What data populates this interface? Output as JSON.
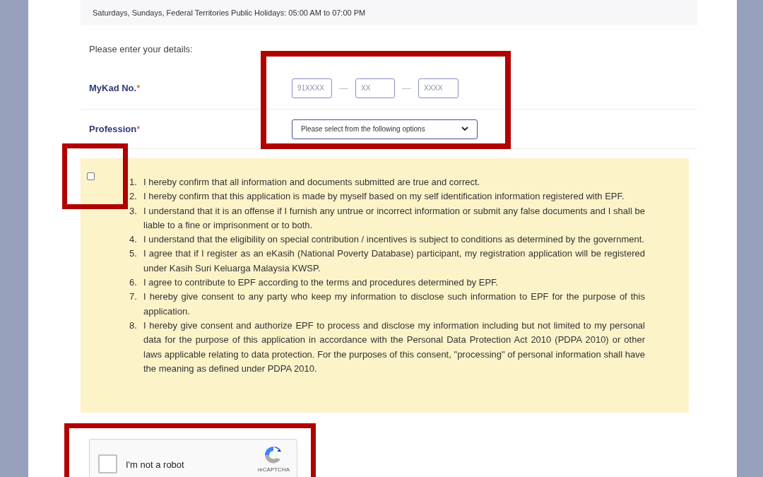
{
  "hours_note": "Saturdays, Sundays, Federal Territories Public Holidays: 05:00 AM to 07:00 PM",
  "intro": "Please enter your details:",
  "mykad": {
    "label": "MyKad No.",
    "required_mark": "*",
    "fields": [
      {
        "placeholder": "91XXXX"
      },
      {
        "placeholder": "XX"
      },
      {
        "placeholder": "XXXX"
      }
    ],
    "separator": "—"
  },
  "profession": {
    "label": "Profession",
    "required_mark": "*",
    "value": "Please select from the following options"
  },
  "declaration": {
    "checked": false,
    "items": [
      {
        "number": "1.",
        "text": "I hereby confirm that all information and documents submitted are true and correct."
      },
      {
        "number": "2.",
        "text": "I hereby confirm that this application is made by myself based on my self identification information registered with EPF."
      },
      {
        "number": "3.",
        "text": "I understand that it is an offense if I furnish any untrue or incorrect information or submit any false documents and I shall be liable to a fine or imprisonment or to both."
      },
      {
        "number": "4.",
        "text": "I understand that the eligibility on special contribution / incentives is subject to conditions as determined by the government."
      },
      {
        "number": "5.",
        "text": "I agree that if I register as an eKasih (National Poverty Database) participant, my registration application will be registered under Kasih Suri Keluarga Malaysia KWSP."
      },
      {
        "number": "6.",
        "text": "I agree to contribute to EPF according to the terms and procedures determined by EPF."
      },
      {
        "number": "7.",
        "text": "I hereby give consent to any party who keep my information to disclose such information to EPF for the purpose of this application."
      },
      {
        "number": "8.",
        "text": "I hereby give consent and authorize EPF to process and disclose my information including but not limited to my personal data for the purpose of this application in accordance with the Personal Data Protection Act 2010 (PDPA 2010) or other laws applicable relating to data protection. For the purposes of this consent, \"processing\" of personal information shall have the meaning as defined under PDPA 2010."
      }
    ]
  },
  "captcha": {
    "label": "I'm not a robot",
    "brand": "reCAPTCHA",
    "checked": false
  }
}
